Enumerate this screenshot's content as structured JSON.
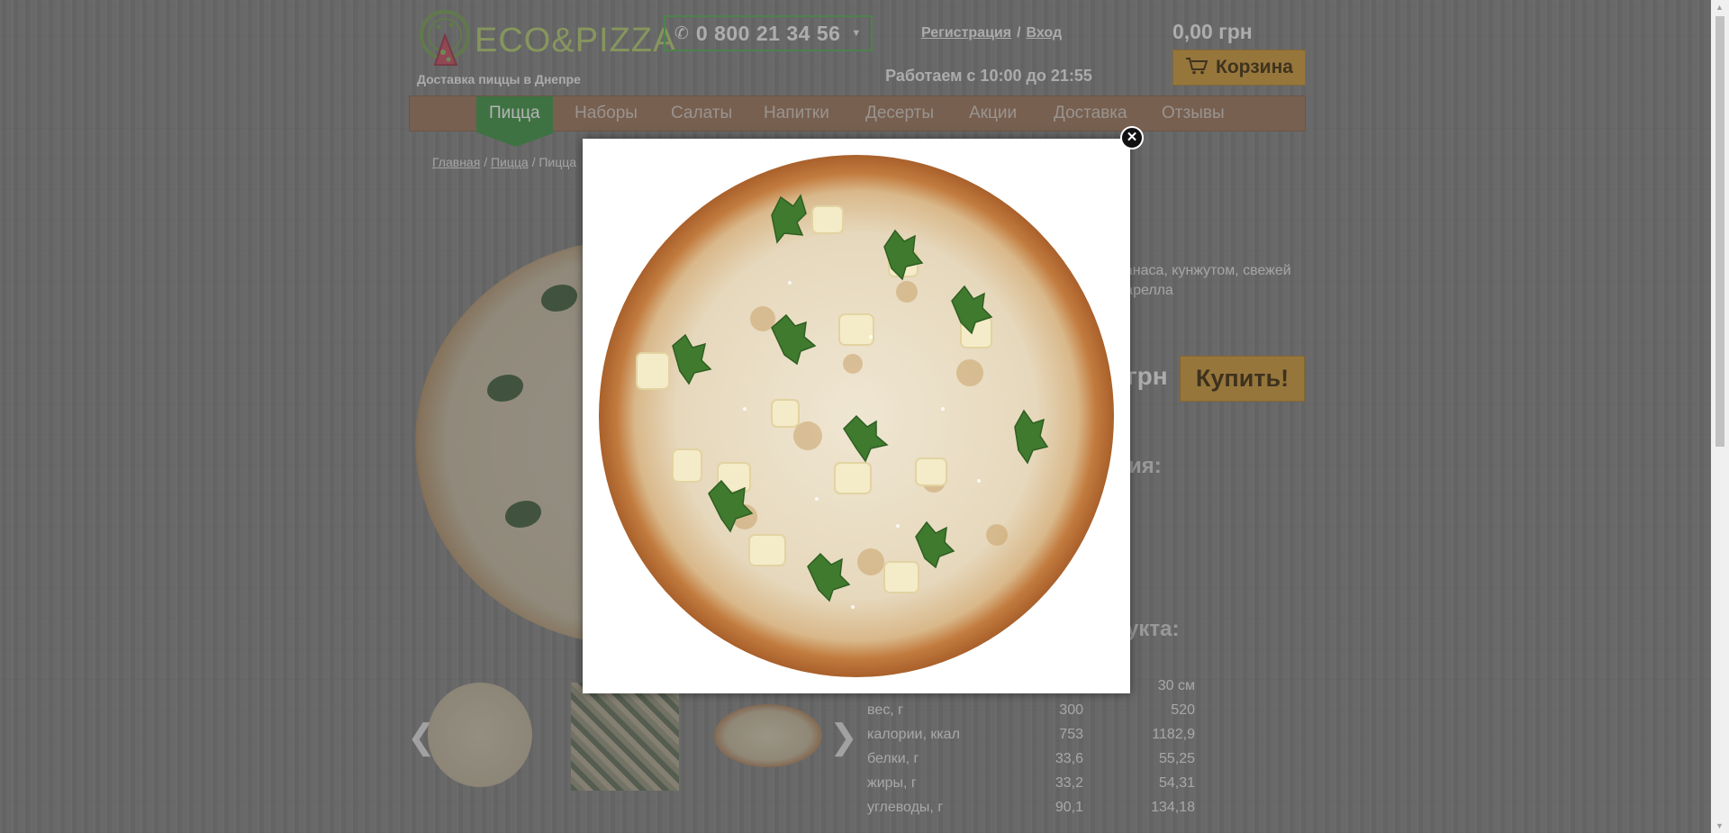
{
  "header": {
    "logo": "ECO&PIZZA",
    "tagline": "Доставка пиццы в Днепре",
    "phone": "0 800 21 34 56",
    "register_label": "Регистрация",
    "login_label": "Вход",
    "auth_separator": "/",
    "hours": "Работаем с 10:00 до 21:55",
    "cart_total": "0,00 грн",
    "cart_label": "Корзина"
  },
  "nav": {
    "items": [
      "Пицца",
      "Наборы",
      "Салаты",
      "Напитки",
      "Десерты",
      "Акции",
      "Доставка",
      "Отзывы"
    ]
  },
  "breadcrumb": {
    "home": "Главная",
    "pizza": "Пицца",
    "current": "Пицца",
    "sep": "/"
  },
  "product": {
    "desc_line1": "нанаса, кунжутом, свежей",
    "desc_line2": "царелла",
    "price_unit": "грн",
    "buy_label": "Купить!",
    "heading_frag_1": "ия:",
    "heading_frag_2": "укта:"
  },
  "nutrition": {
    "size_header": "30 см",
    "rows": [
      {
        "label": "вес, г",
        "v1": "300",
        "v2": "520"
      },
      {
        "label": "калории, ккал",
        "v1": "753",
        "v2": "1182,9"
      },
      {
        "label": "белки, г",
        "v1": "33,6",
        "v2": "55,25"
      },
      {
        "label": "жиры, г",
        "v1": "33,2",
        "v2": "54,31"
      },
      {
        "label": "углеводы, г",
        "v1": "90,1",
        "v2": "134,18"
      }
    ]
  },
  "gallery": {
    "prev_arrow": "❮",
    "next_arrow": "❯"
  },
  "modal": {
    "close_glyph": "✕"
  },
  "colors": {
    "accent_green": "#4c9a52",
    "button_gold": "#d3a048"
  }
}
